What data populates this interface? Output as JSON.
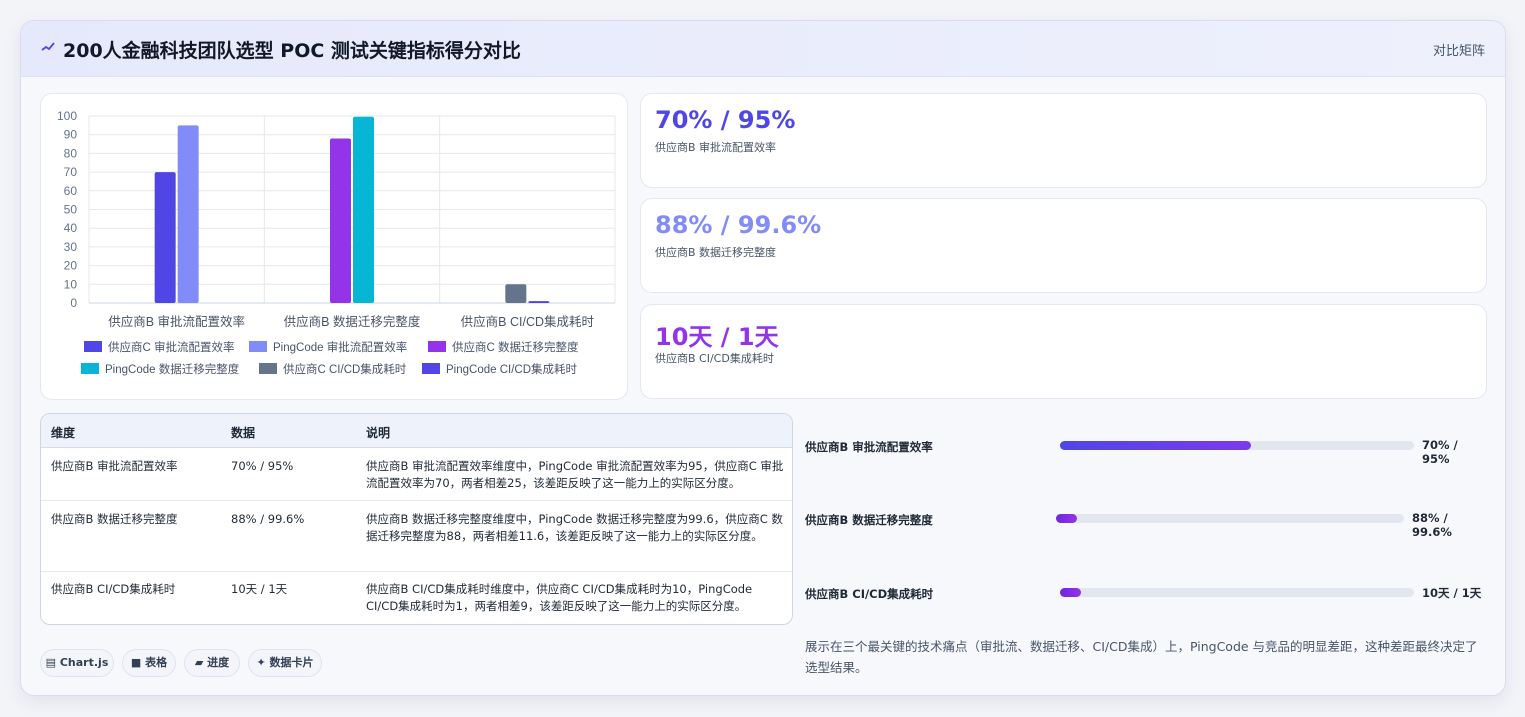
{
  "header": {
    "title": "200人金融科技团队选型 POC 测试关键指标得分对比",
    "right_label": "对比矩阵",
    "icon": "sparkline-icon"
  },
  "chart_data": {
    "type": "bar",
    "categories": [
      "供应商B 审批流配置效率",
      "供应商B 数据迁移完整度",
      "供应商B CI/CD集成耗时"
    ],
    "ylim": [
      0,
      100
    ],
    "yticks": [
      0,
      10,
      20,
      30,
      40,
      50,
      60,
      70,
      80,
      90,
      100
    ],
    "grid": true,
    "legend_position": "bottom",
    "series": [
      {
        "name": "供应商C 审批流配置效率",
        "color": "#4f46e5",
        "values": [
          70,
          null,
          null
        ]
      },
      {
        "name": "PingCode 审批流配置效率",
        "color": "#818cf8",
        "values": [
          95,
          null,
          null
        ]
      },
      {
        "name": "供应商C 数据迁移完整度",
        "color": "#9333ea",
        "values": [
          null,
          88,
          null
        ]
      },
      {
        "name": "PingCode 数据迁移完整度",
        "color": "#06b6d4",
        "values": [
          null,
          99.6,
          null
        ]
      },
      {
        "name": "供应商C CI/CD集成耗时",
        "color": "#64748b",
        "values": [
          null,
          null,
          10
        ]
      },
      {
        "name": "PingCode CI/CD集成耗时",
        "color": "#4f46e5",
        "values": [
          null,
          null,
          1
        ]
      }
    ]
  },
  "kpis": [
    {
      "value": "70% / 95%",
      "label": "供应商B 审批流配置效率",
      "color": "#4f46e5"
    },
    {
      "value": "88% / 99.6%",
      "label": "供应商B 数据迁移完整度",
      "color": "#818cf8"
    },
    {
      "value": "10天 / 1天",
      "label": "供应商B CI/CD集成耗时",
      "color": "#9333ea"
    }
  ],
  "table": {
    "headers": [
      "维度",
      "数据",
      "说明"
    ],
    "rows": [
      {
        "dim": "供应商B 审批流配置效率",
        "data": "70% / 95%",
        "desc": "供应商B 审批流配置效率维度中，PingCode 审批流配置效率为95，供应商C 审批流配置效率为70，两者相差25，该差距反映了这一能力上的实际区分度。"
      },
      {
        "dim": "供应商B 数据迁移完整度",
        "data": "88% / 99.6%",
        "desc": "供应商B 数据迁移完整度维度中，PingCode 数据迁移完整度为99.6，供应商C 数据迁移完整度为88，两者相差11.6，该差距反映了这一能力上的实际区分度。"
      },
      {
        "dim": "供应商B CI/CD集成耗时",
        "data": "10天 / 1天",
        "desc": "供应商B CI/CD集成耗时维度中，供应商C CI/CD集成耗时为10，PingCode CI/CD集成耗时为1，两者相差9，该差距反映了这一能力上的实际区分度。"
      }
    ]
  },
  "progress": [
    {
      "label": "供应商B 审批流配置效率",
      "value": "70% / 95%",
      "fraction": 0.54
    },
    {
      "label": "供应商B 数据迁移完整度",
      "value": "88% / 99.6%",
      "fraction": 0.06
    },
    {
      "label": "供应商B CI/CD集成耗时",
      "value": "10天 / 1天",
      "fraction": 0.06
    }
  ],
  "note": "展示在三个最关键的技术痛点（审批流、数据迁移、CI/CD集成）上，PingCode 与竞品的明显差距，这种差距最终决定了选型结果。",
  "tags": [
    {
      "icon": "chart-icon",
      "glyph": "▤",
      "label": "Chart.js"
    },
    {
      "icon": "table-icon",
      "glyph": "■",
      "label": "表格"
    },
    {
      "icon": "progress-icon",
      "glyph": "▰",
      "label": "进度"
    },
    {
      "icon": "card-icon",
      "glyph": "✦",
      "label": "数据卡片"
    }
  ]
}
